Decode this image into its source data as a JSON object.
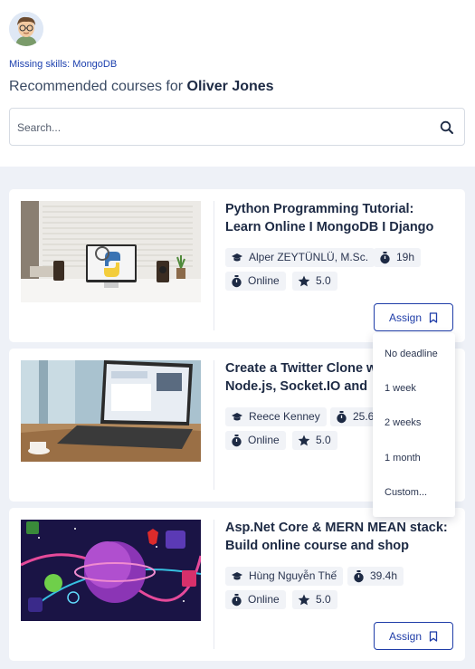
{
  "header": {
    "missing_skills": "Missing skills: MongoDB",
    "recommend_prefix": "Recommended courses for ",
    "user_name": "Oliver Jones"
  },
  "search": {
    "placeholder": "Search..."
  },
  "courses": [
    {
      "title_line1": "Python Programming Tutorial:",
      "title_line2": "Learn Online I MongoDB I Django",
      "author": "Alper ZEYTÜNLÜ, M.Sc.",
      "duration": "19h",
      "mode": "Online",
      "rating": "5.0",
      "assign_label": "Assign"
    },
    {
      "title_line1": "Create a Twitter Clone w",
      "title_line2": "Node.js, Socket.IO and",
      "author": "Reece Kenney",
      "duration": "25.6",
      "mode": "Online",
      "rating": "5.0"
    },
    {
      "title_line1": "Asp.Net Core & MERN MEAN stack:",
      "title_line2": "Build online course and shop",
      "author": "Hùng Nguyễn Thế",
      "duration": "39.4h",
      "mode": "Online",
      "rating": "5.0",
      "assign_label": "Assign"
    }
  ],
  "deadline_menu": [
    "No deadline",
    "1 week",
    "2 weeks",
    "1 month",
    "Custom..."
  ],
  "colors": {
    "accent": "#1f3da8",
    "background": "#eef1f7",
    "text": "#1d2a44"
  }
}
